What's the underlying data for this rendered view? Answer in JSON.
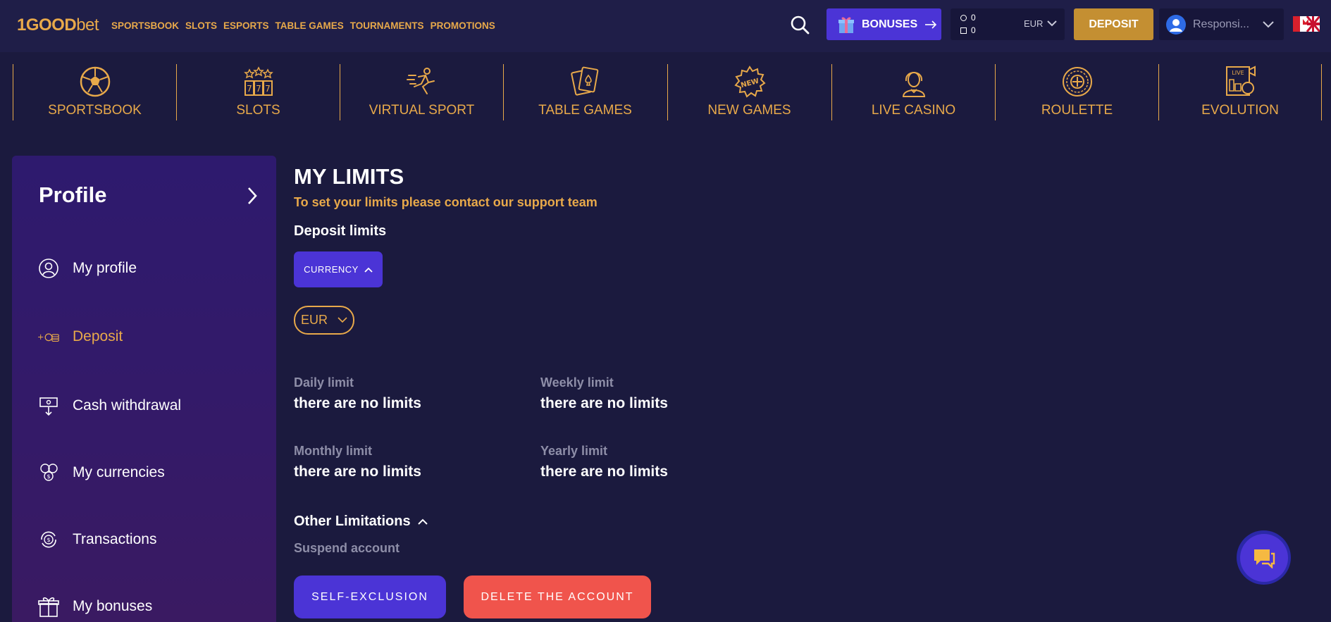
{
  "brand": {
    "logo_main": "1GOOD",
    "logo_suffix": "bet"
  },
  "topnav": [
    "SPORTSBOOK",
    "SLOTS",
    "ESPORTS",
    "TABLE GAMES",
    "TOURNAMENTS",
    "PROMOTIONS"
  ],
  "header": {
    "bonuses_label": "BONUSES",
    "balance_main": "0",
    "balance_bonus": "0",
    "currency": "EUR",
    "deposit_label": "DEPOSIT",
    "user_name": "Responsi..."
  },
  "categories": [
    {
      "label": "SPORTSBOOK",
      "icon": "soccer-ball-icon"
    },
    {
      "label": "SLOTS",
      "icon": "slot-machine-icon"
    },
    {
      "label": "VIRTUAL SPORT",
      "icon": "runner-icon"
    },
    {
      "label": "TABLE GAMES",
      "icon": "playing-cards-icon"
    },
    {
      "label": "NEW GAMES",
      "icon": "new-badge-icon"
    },
    {
      "label": "LIVE CASINO",
      "icon": "dealer-icon"
    },
    {
      "label": "ROULETTE",
      "icon": "roulette-icon"
    },
    {
      "label": "EVOLUTION",
      "icon": "live-camera-icon"
    }
  ],
  "sidebar": {
    "title": "Profile",
    "items": [
      {
        "label": "My profile",
        "icon": "user-circle-icon"
      },
      {
        "label": "Deposit",
        "icon": "coins-plus-icon",
        "active": true
      },
      {
        "label": "Cash withdrawal",
        "icon": "withdraw-icon"
      },
      {
        "label": "My currencies",
        "icon": "currencies-icon"
      },
      {
        "label": "Transactions",
        "icon": "transactions-icon"
      },
      {
        "label": "My bonuses",
        "icon": "gift-icon"
      }
    ]
  },
  "main": {
    "title": "MY LIMITS",
    "subtitle": "To set your limits please contact our support team",
    "deposit_heading": "Deposit limits",
    "currency_button": "CURRENCY",
    "currency_select": "EUR",
    "limits": {
      "daily": {
        "label": "Daily limit",
        "value": "there are no limits"
      },
      "weekly": {
        "label": "Weekly limit",
        "value": "there are no limits"
      },
      "monthly": {
        "label": "Monthly limit",
        "value": "there are no limits"
      },
      "yearly": {
        "label": "Yearly limit",
        "value": "there are no limits"
      }
    },
    "other_heading": "Other Limitations",
    "suspend_label": "Suspend account",
    "self_exclusion": "SELF-EXCLUSION",
    "delete_account": "DELETE THE ACCOUNT"
  },
  "colors": {
    "accent_gold": "#e8a94a",
    "primary_purple": "#4b34d6",
    "danger_red": "#f0544c",
    "background": "#1b1a3e"
  }
}
